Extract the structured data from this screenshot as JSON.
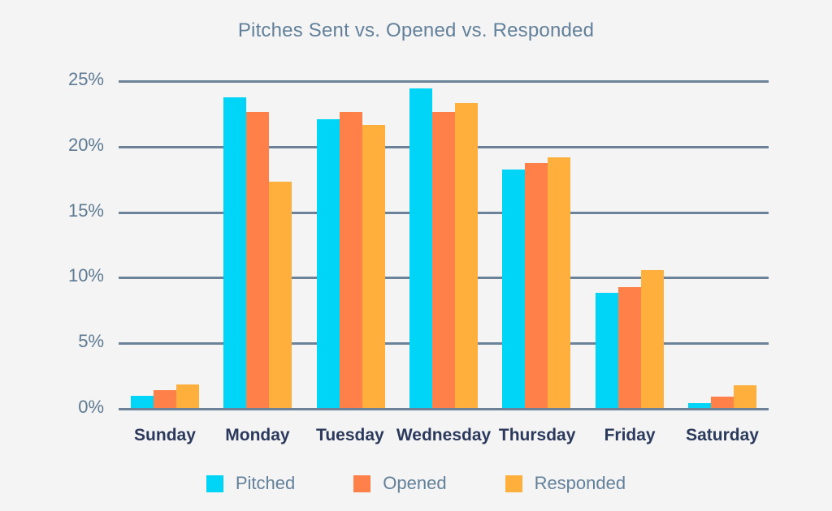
{
  "chart_data": {
    "type": "bar",
    "title": "Pitches Sent vs. Opened vs. Responded",
    "xlabel": "",
    "ylabel": "",
    "ylim": [
      0,
      25
    ],
    "ytick_labels": [
      "25%",
      "20%",
      "15%",
      "10%",
      "5%",
      "0%"
    ],
    "ytick_values": [
      25,
      20,
      15,
      10,
      5,
      0
    ],
    "grid": true,
    "legend_position": "bottom",
    "categories": [
      "Sunday",
      "Monday",
      "Tuesday",
      "Wednesday",
      "Thursday",
      "Friday",
      "Saturday"
    ],
    "series": [
      {
        "name": "Pitched",
        "color": "#00d5f7",
        "values": [
          0.9,
          23.7,
          22.0,
          24.4,
          18.2,
          8.8,
          0.35
        ]
      },
      {
        "name": "Opened",
        "color": "#ff8049",
        "values": [
          1.35,
          22.6,
          22.6,
          22.6,
          18.7,
          9.25,
          0.85
        ]
      },
      {
        "name": "Responded",
        "color": "#ffaf3b",
        "values": [
          1.8,
          17.25,
          21.6,
          23.25,
          19.1,
          10.55,
          1.75
        ]
      }
    ]
  },
  "style": {
    "background": "#f4f4f4",
    "title_color": "#62809a",
    "gridline_color": "#6b8299",
    "ytick_color": "#5e7a92",
    "xtick_color": "#2b3a5c",
    "legend_text_color": "#62809a"
  }
}
